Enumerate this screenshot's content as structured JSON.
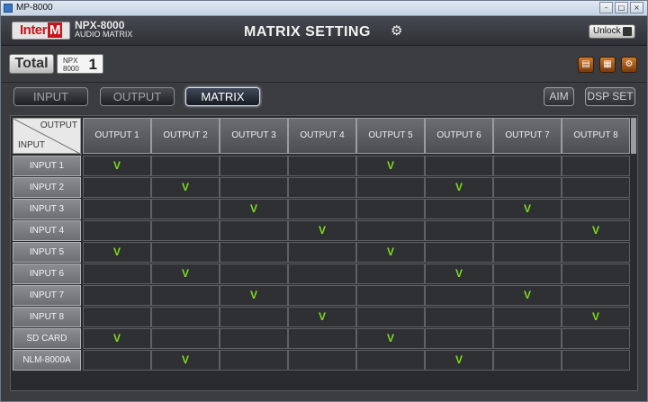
{
  "window": {
    "title": "MP-8000",
    "minimize": "–",
    "maximize": "□",
    "close": "×"
  },
  "header": {
    "logo_text": "Inter",
    "logo_m": "M",
    "model_line1": "NPX-8000",
    "model_line2": "AUDIO MATRIX",
    "title": "MATRIX SETTING",
    "gear_icon": "⚙",
    "unlock_label": "Unlock"
  },
  "bar2": {
    "total_label": "Total",
    "npx_line1": "NPX",
    "npx_line2": "8000",
    "npx_number": "1",
    "tools": [
      "▤",
      "▦",
      "⚙"
    ]
  },
  "nav": {
    "input_label": "INPUT",
    "output_label": "OUTPUT",
    "matrix_label": "MATRIX",
    "aim_label": "AIM",
    "dsp_label": "DSP SET"
  },
  "matrix": {
    "corner_output": "OUTPUT",
    "corner_input": "INPUT",
    "check_mark": "V",
    "check_color": "#7fdc1e",
    "outputs": [
      "OUTPUT 1",
      "OUTPUT 2",
      "OUTPUT 3",
      "OUTPUT 4",
      "OUTPUT 5",
      "OUTPUT 6",
      "OUTPUT 7",
      "OUTPUT 8"
    ],
    "inputs": [
      "INPUT 1",
      "INPUT 2",
      "INPUT 3",
      "INPUT 4",
      "INPUT 5",
      "INPUT 6",
      "INPUT 7",
      "INPUT 8",
      "SD CARD",
      "NLM-8000A"
    ],
    "routing": [
      [
        1,
        0,
        0,
        0,
        1,
        0,
        0,
        0
      ],
      [
        0,
        1,
        0,
        0,
        0,
        1,
        0,
        0
      ],
      [
        0,
        0,
        1,
        0,
        0,
        0,
        1,
        0
      ],
      [
        0,
        0,
        0,
        1,
        0,
        0,
        0,
        1
      ],
      [
        1,
        0,
        0,
        0,
        1,
        0,
        0,
        0
      ],
      [
        0,
        1,
        0,
        0,
        0,
        1,
        0,
        0
      ],
      [
        0,
        0,
        1,
        0,
        0,
        0,
        1,
        0
      ],
      [
        0,
        0,
        0,
        1,
        0,
        0,
        0,
        1
      ],
      [
        1,
        0,
        0,
        0,
        1,
        0,
        0,
        0
      ],
      [
        0,
        1,
        0,
        0,
        0,
        1,
        0,
        0
      ]
    ]
  }
}
